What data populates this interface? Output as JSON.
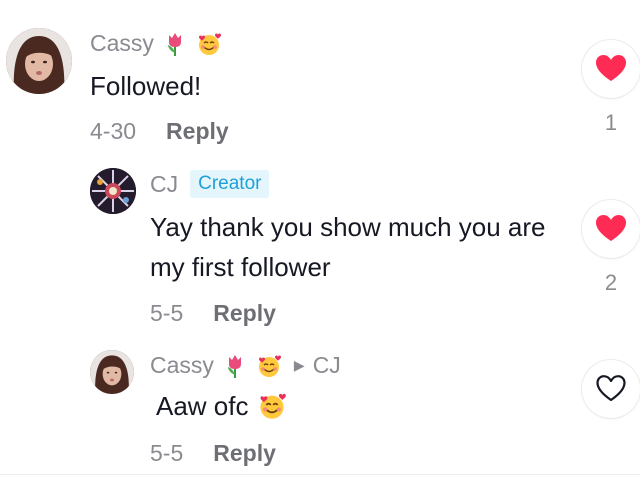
{
  "comments": [
    {
      "author": "Cassy",
      "author_emojis": [
        "tulip-emoji",
        "smiling-face-with-hearts-emoji"
      ],
      "text": "Followed!",
      "date": "4-30",
      "reply_label": "Reply",
      "like_count": "1",
      "liked": true
    },
    {
      "author": "CJ",
      "badge": "Creator",
      "text": "Yay thank you show much you are my first follower",
      "date": "5-5",
      "reply_label": "Reply",
      "like_count": "2",
      "liked": true
    },
    {
      "author": "Cassy",
      "author_emojis": [
        "tulip-emoji",
        "smiling-face-with-hearts-emoji"
      ],
      "reply_to": "CJ",
      "text": "Aaw ofc",
      "text_emoji": "smiling-face-with-hearts-emoji",
      "date": "5-5",
      "reply_label": "Reply",
      "like_count": "",
      "liked": false
    }
  ],
  "colors": {
    "like_active": "#fe2c55",
    "creator_badge_text": "#20a0d8",
    "creator_badge_bg": "#e4f5fc",
    "muted_text": "#8a8b91"
  }
}
